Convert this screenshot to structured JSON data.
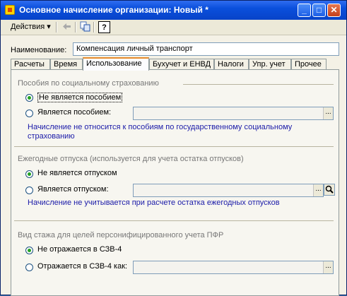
{
  "window": {
    "title": "Основное начисление организации: Новый *"
  },
  "titlebar_buttons": {
    "minimize": "_",
    "maximize": "□",
    "close": "✕"
  },
  "toolbar": {
    "actions_label": "Действия",
    "actions_arrow": "▾",
    "help_label": "?"
  },
  "name_field": {
    "label": "Наименование:",
    "value": "Компенсация личный транспорт"
  },
  "tabs": [
    {
      "label": "Расчеты"
    },
    {
      "label": "Время"
    },
    {
      "label": "Использование"
    },
    {
      "label": "Бухучет и ЕНВД"
    },
    {
      "label": "Налоги"
    },
    {
      "label": "Упр. учет"
    },
    {
      "label": "Прочее"
    }
  ],
  "active_tab": "Использование",
  "social": {
    "title": "Пособия по социальному страхованию",
    "option_not": "Не является пособием",
    "option_is": "Является пособием:",
    "field_value": "",
    "note": "Начисление не относится к пособиям по государственному социальному страхованию",
    "selected": "not"
  },
  "vacation": {
    "title": "Ежегодные отпуска (используется для учета остатка отпусков)",
    "option_not": "Не является отпуском",
    "option_is": "Является отпуском:",
    "field_value": "",
    "note": "Начисление не учитывается при расчете остатка ежегодных отпусков",
    "selected": "not"
  },
  "pfr": {
    "title": "Вид стажа для целей персонифицированного учета ПФР",
    "option_not": "Не отражается в СЗВ-4",
    "option_is": "Отражается в СЗВ-4 как:",
    "field_value": "",
    "selected": "not"
  },
  "ellipsis": "..."
}
